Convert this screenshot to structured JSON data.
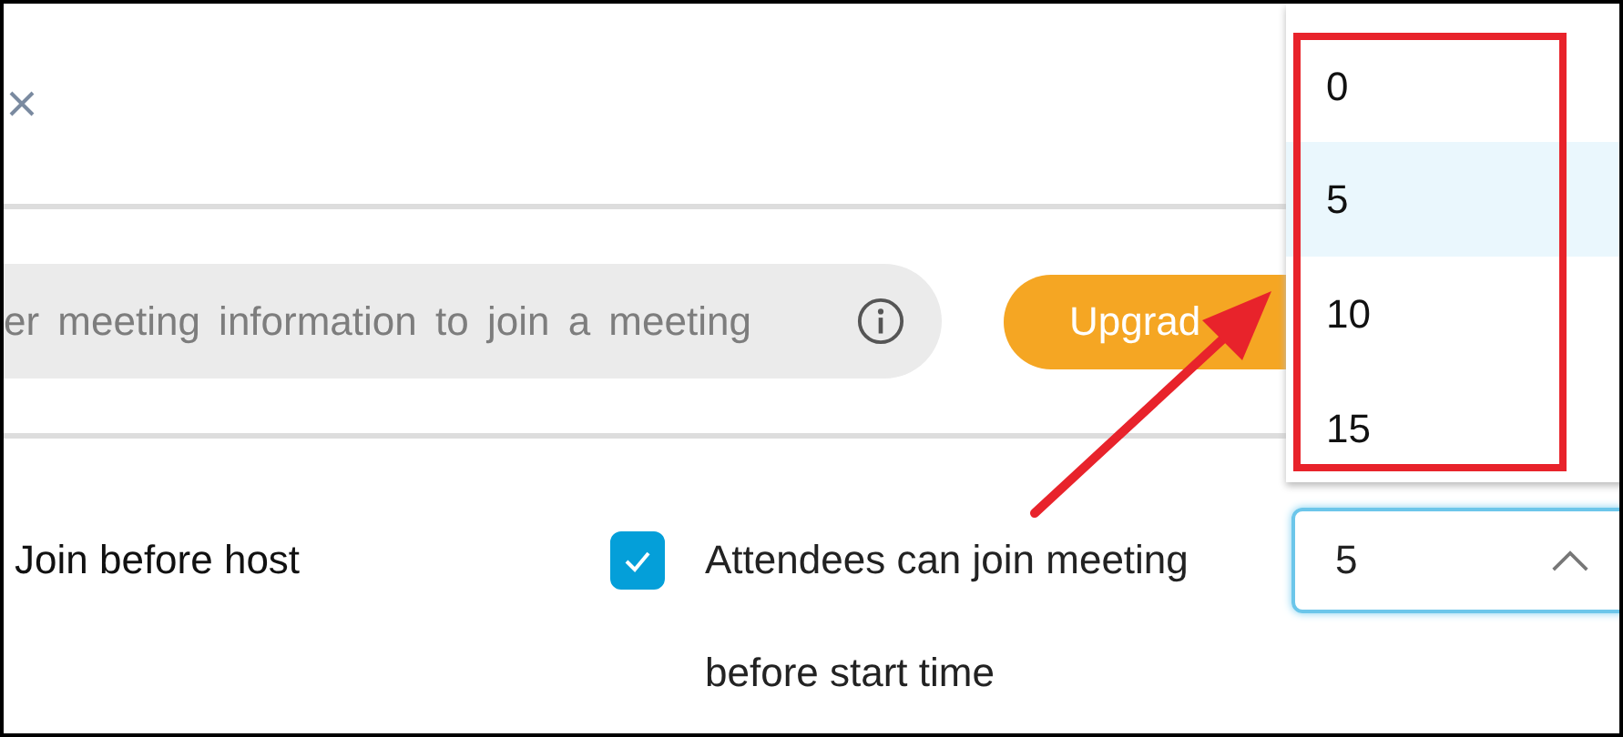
{
  "search": {
    "placeholder": "er meeting information to join a meeting"
  },
  "upgrade_button": {
    "label": "Upgrad"
  },
  "setting": {
    "label": "Join before host",
    "checkbox": {
      "checked": true,
      "label": "Attendees can join meeting before start time"
    },
    "select": {
      "value": "5",
      "expanded": true,
      "options": [
        {
          "label": "0",
          "selected": false
        },
        {
          "label": "5",
          "selected": true
        },
        {
          "label": "10",
          "selected": false
        },
        {
          "label": "15",
          "selected": false
        }
      ]
    }
  }
}
